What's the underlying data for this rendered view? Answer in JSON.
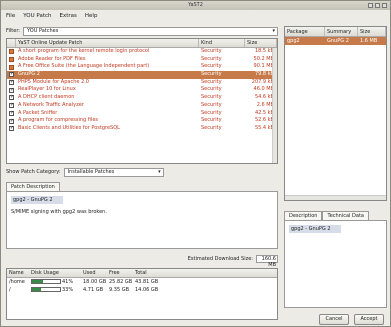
{
  "window": {
    "title": "YaST2"
  },
  "menu": [
    "File",
    "YOU Patch",
    "Extras",
    "Help"
  ],
  "filter": {
    "label": "Filter:",
    "value": "YOU Patches"
  },
  "patch_table": {
    "headers": [
      "",
      "YaST Online Update Patch",
      "Kind",
      "Size"
    ],
    "rows": [
      {
        "name": "A short program for the kernel remote login protocol",
        "kind": "Security",
        "size": "18.5 kB",
        "state": "warn"
      },
      {
        "name": "Adobe Reader for PDF Files",
        "kind": "Security",
        "size": "50.2 MB",
        "state": "warn"
      },
      {
        "name": "A Free Office Suite (the Language Independent part)",
        "kind": "Security",
        "size": "90.1 MB",
        "state": "warn"
      },
      {
        "name": "GnuPG 2",
        "kind": "Security",
        "size": "79.8 kB",
        "state": "sel"
      },
      {
        "name": "PHP5 Module for Apache 2.0",
        "kind": "Security",
        "size": "207.9 kB",
        "state": "on"
      },
      {
        "name": "RealPlayer 10 for Linux",
        "kind": "Security",
        "size": "46.0 MB",
        "state": "on"
      },
      {
        "name": "A DHCP client daemon",
        "kind": "Security",
        "size": "54.6 kB",
        "state": "on"
      },
      {
        "name": "A Network Traffic Analyzer",
        "kind": "Security",
        "size": "2.6 MB",
        "state": "on"
      },
      {
        "name": "A Packet Sniffer",
        "kind": "Security",
        "size": "42.5 kB",
        "state": "on"
      },
      {
        "name": "A program for compressing files",
        "kind": "Security",
        "size": "52.6 kB",
        "state": "on"
      },
      {
        "name": "Basic Clients and Utilities for PostgreSQL",
        "kind": "Security",
        "size": "55.4 kB",
        "state": "on"
      }
    ]
  },
  "category": {
    "label": "Show Patch Category:",
    "value": "Installable Patches"
  },
  "tabs_left": [
    "Patch Description"
  ],
  "description": {
    "heading": "gpg2 - GnuPG 2",
    "text": "S/MIME signing with gpg2 was broken."
  },
  "download": {
    "label": "Estimated Download Size:",
    "value": "160.6 MB"
  },
  "disk_table": {
    "headers": [
      "Name",
      "Disk Usage",
      "Used",
      "Free",
      "Total"
    ],
    "rows": [
      {
        "name": "/home",
        "pct": "41%",
        "fill": 0.41,
        "used": "18.00 GB",
        "free": "25.82 GB",
        "total": "43.81 GB"
      },
      {
        "name": "/",
        "pct": "33%",
        "fill": 0.33,
        "used": "4.71 GB",
        "free": "9.35 GB",
        "total": "14.06 GB"
      }
    ]
  },
  "package_table": {
    "headers": [
      "Package",
      "Summary",
      "Size"
    ],
    "rows": [
      {
        "package": "gpg2",
        "summary": "GnuPG 2",
        "size": "1.6 MB"
      }
    ]
  },
  "tabs_right": [
    "Description",
    "Technical Data"
  ],
  "package_desc": {
    "heading": "gpg2 - GnuPG 2"
  },
  "buttons": {
    "cancel": "Cancel",
    "accept": "Accept"
  }
}
